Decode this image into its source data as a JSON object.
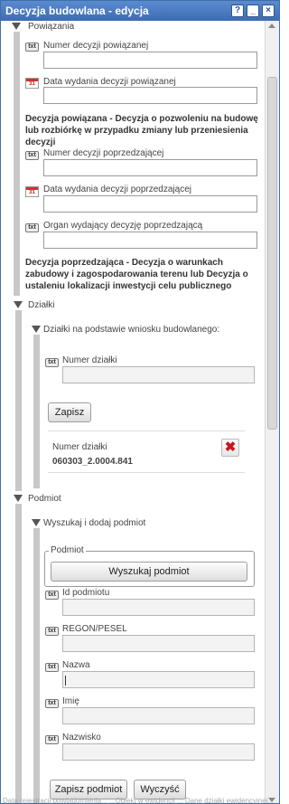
{
  "window": {
    "title": "Decyzja budowlana - edycja",
    "help_label": "?",
    "minimize_label": "_",
    "close_label": "×"
  },
  "powiazania": {
    "section_title": "Powiązania",
    "field_nr_powiazanej": {
      "label": "Numer decyzji powiązanej",
      "value": "",
      "type_icon": "txt"
    },
    "field_data_powiazanej": {
      "label": "Data wydania decyzji powiązanej",
      "value": "",
      "type_icon": "31"
    },
    "note_powiazana": "Decyzja powiązana - Decyzja o pozwoleniu na budowę lub rozbiórkę w przypadku zmiany lub przeniesienia decyzji",
    "field_nr_poprzedzajacej": {
      "label": "Numer decyzji poprzedzającej",
      "value": "",
      "type_icon": "txt"
    },
    "field_data_poprzedzajacej": {
      "label": "Data wydania decyzji poprzedzającej",
      "value": "",
      "type_icon": "31"
    },
    "field_organ": {
      "label": "Organ wydający decyzję poprzedzającą",
      "value": "",
      "type_icon": "txt"
    },
    "note_poprzedzajaca": "Decyzja poprzedzająca - Decyzja o warunkach zabudowy i zagospodarowania terenu lub Decyzja o ustaleniu lokalizacji inwestycji celu publicznego"
  },
  "dzialki": {
    "section_title": "Działki",
    "subsection_title": "Działki na podstawie wniosku budowlanego:",
    "field_numer": {
      "label": "Numer działki",
      "value": "",
      "type_icon": "txt"
    },
    "save_label": "Zapisz",
    "list_header": "Numer działki",
    "list_items": [
      "060303_2.0004.841"
    ],
    "delete_glyph": "✖"
  },
  "podmiot": {
    "section_title": "Podmiot",
    "subsection_title": "Wyszukaj i dodaj podmiot",
    "group_legend": "Podmiot",
    "search_label": "Wyszukaj podmiot",
    "fields": [
      {
        "label": "Id podmiotu",
        "value": "",
        "type_icon": "txt"
      },
      {
        "label": "REGON/PESEL",
        "value": "",
        "type_icon": "txt"
      },
      {
        "label": "Nazwa",
        "value": "",
        "type_icon": "txt"
      },
      {
        "label": "Imię",
        "value": "",
        "type_icon": "txt"
      },
      {
        "label": "Nazwisko",
        "value": "",
        "type_icon": "txt"
      }
    ],
    "save_label": "Zapisz podmiot",
    "clear_label": "Wyczyść"
  },
  "status_text": "Data rejestracji powiadomienia...   ...Obiekt w ewidencji ... Dane działki ewidencyjnej..."
}
